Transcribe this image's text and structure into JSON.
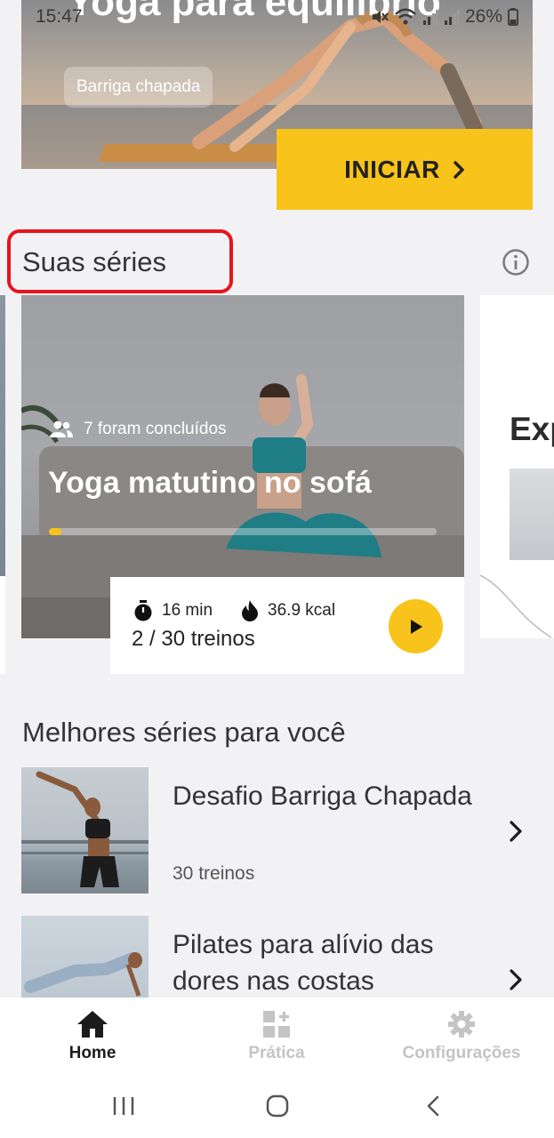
{
  "status_bar": {
    "time": "15:47",
    "battery": "26%",
    "icons": [
      "mute-icon",
      "wifi-icon",
      "signal-icon",
      "signal-icon",
      "battery-icon"
    ]
  },
  "hero": {
    "title": "Yoga para equilíbrio",
    "tag": "Barriga chapada",
    "start_label": "INICIAR",
    "start_icon": "chevron-right-icon",
    "accent": "#f8c31a"
  },
  "your_series": {
    "title": "Suas séries",
    "info_icon": "info-icon",
    "highlight_color": "#e8131c",
    "current": {
      "completed_text": "7 foram concluídos",
      "name": "Yoga matutino no sofá",
      "progress": 0.033,
      "duration": "16 min",
      "calories": "36.9 kcal",
      "workouts": "2 / 30 treinos"
    },
    "next_card_title": "Exp"
  },
  "best_series": {
    "title": "Melhores séries para você",
    "items": [
      {
        "title": "Desafio Barriga Chapada",
        "subtitle": "30 treinos"
      },
      {
        "title": "Pilates para alívio das dores nas costas",
        "subtitle": ""
      }
    ]
  },
  "bottom_nav": {
    "items": [
      {
        "label": "Home",
        "icon": "home-icon",
        "active": true
      },
      {
        "label": "Prática",
        "icon": "practice-grid-icon",
        "active": false
      },
      {
        "label": "Configurações",
        "icon": "gear-icon",
        "active": false
      }
    ],
    "active_color": "#1c1c1c",
    "inactive_color": "#c4c4c4"
  },
  "system_nav": [
    "recent-apps-icon",
    "home-circle-icon",
    "back-icon"
  ]
}
